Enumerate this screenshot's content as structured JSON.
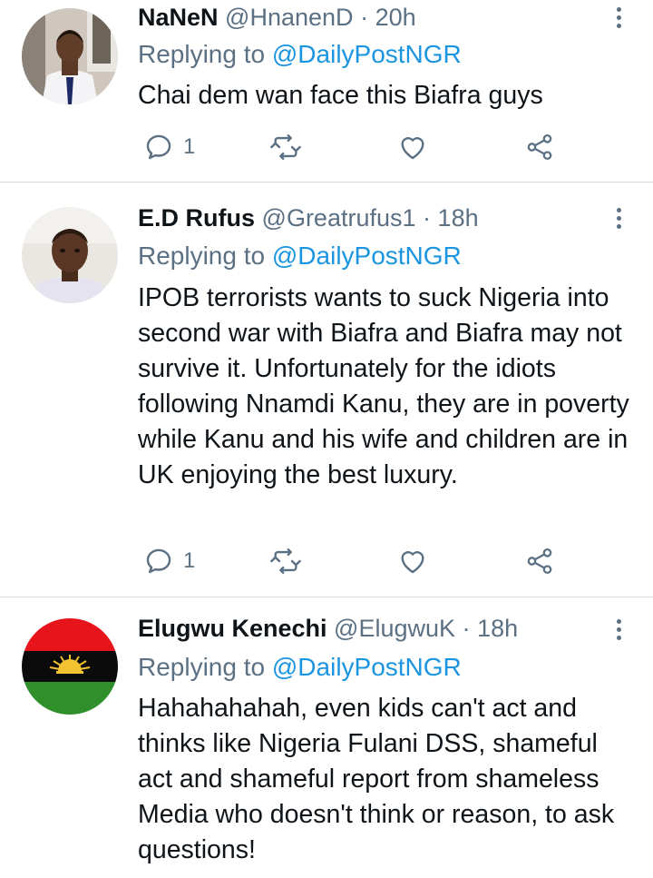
{
  "tweets": [
    {
      "name": "NaNeN",
      "handle": "@HnanenD",
      "time": "20h",
      "replying_prefix": "Replying to",
      "replying_to": "@DailyPostNGR",
      "text": "Chai dem wan face this Biafra guys",
      "reply_count": "1",
      "avatar_icon": "man-in-suit-photo"
    },
    {
      "name": "E.D Rufus",
      "handle": "@Greatrufus1",
      "time": "18h",
      "replying_prefix": "Replying to",
      "replying_to": "@DailyPostNGR",
      "text": "IPOB terrorists wants to suck Nigeria into second war with Biafra and Biafra may not survive it. Unfortunately for the idiots following Nnamdi Kanu, they are in poverty while Kanu and his wife and children are in UK enjoying the best luxury.",
      "reply_count": "1",
      "avatar_icon": "man-selfie-photo"
    },
    {
      "name": "Elugwu Kenechi",
      "handle": "@ElugwuK",
      "time": "18h",
      "replying_prefix": "Replying to",
      "replying_to": "@DailyPostNGR",
      "text": "Hahahahahah, even kids can't act and thinks like Nigeria Fulani DSS, shameful act and shameful report from shameless Media who doesn't think or reason, to ask questions!",
      "avatar_icon": "biafra-flag"
    }
  ],
  "separator": "·",
  "colors": {
    "name": "#0f1419",
    "secondary": "#5b7083",
    "mention": "#1b95e0",
    "divider": "#d4d9dd"
  }
}
